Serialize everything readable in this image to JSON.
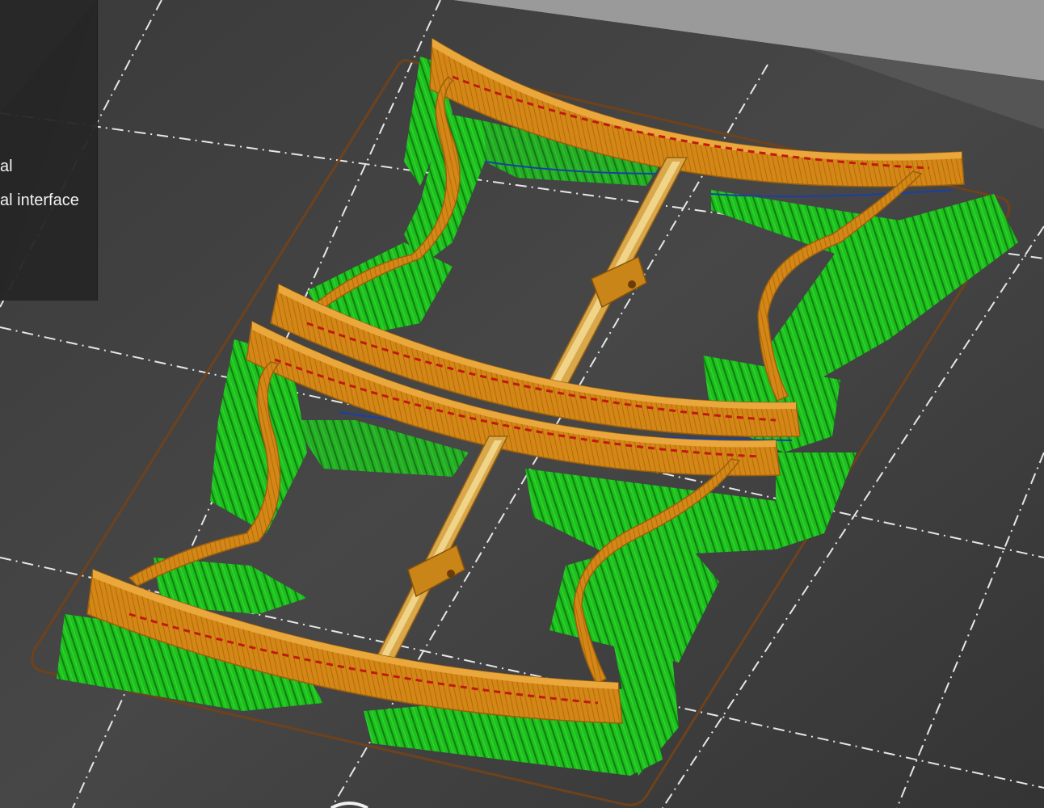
{
  "legend": {
    "items": [
      {
        "label": "al"
      },
      {
        "label": "al interface"
      }
    ]
  },
  "colors": {
    "background": "#2a2a2a",
    "bed": "#3c3c3c",
    "bed_shadow": "#333333",
    "grid_line": "#e8e8e8",
    "skirt": "#7a4a1e",
    "support": "#22cc22",
    "support_dark": "#0f8a0f",
    "support_interface": "#1a3fa8",
    "wall": "#d98c1a",
    "wall_light": "#e8a73a",
    "wall_dark": "#a8650c",
    "infill": "#c01a10",
    "top_fill": "#e0c870"
  },
  "icons": [
    "checkbox-icon"
  ]
}
